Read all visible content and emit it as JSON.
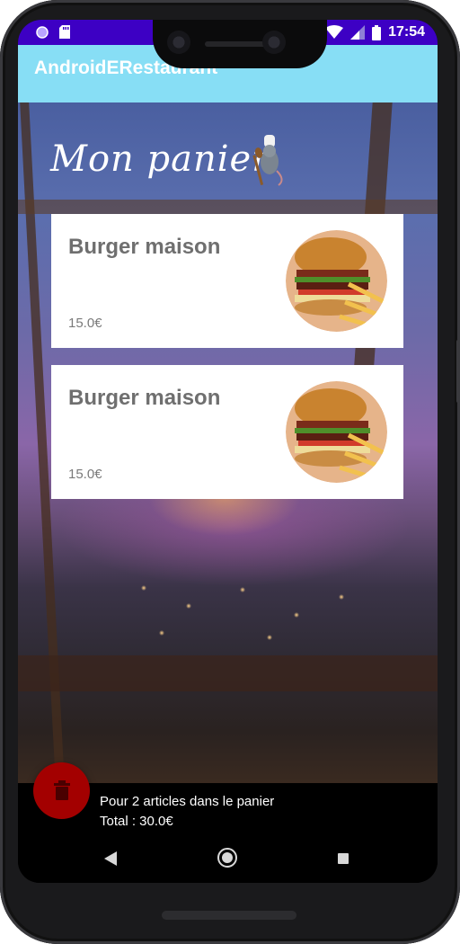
{
  "status_bar": {
    "time": "17:54",
    "left_icons": [
      "circle-notification-icon",
      "sd-card-icon"
    ],
    "right_icons": [
      "wifi-icon",
      "cell-signal-icon",
      "battery-icon"
    ]
  },
  "app_bar": {
    "title": "AndroidERestaurant"
  },
  "page": {
    "title": "Mon panier"
  },
  "cart_items": [
    {
      "name": "Burger maison",
      "price": "15.0€"
    },
    {
      "name": "Burger maison",
      "price": "15.0€"
    }
  ],
  "footer": {
    "summary": "Pour 2 articles dans le panier",
    "total": "Total : 30.0€"
  },
  "colors": {
    "app_bar": "#87def5",
    "status_bar": "#3d00c4",
    "fab": "#a30000",
    "card": "#ffffff"
  },
  "nav_bar": {
    "icons": [
      "back-icon",
      "home-icon",
      "recents-icon"
    ]
  }
}
